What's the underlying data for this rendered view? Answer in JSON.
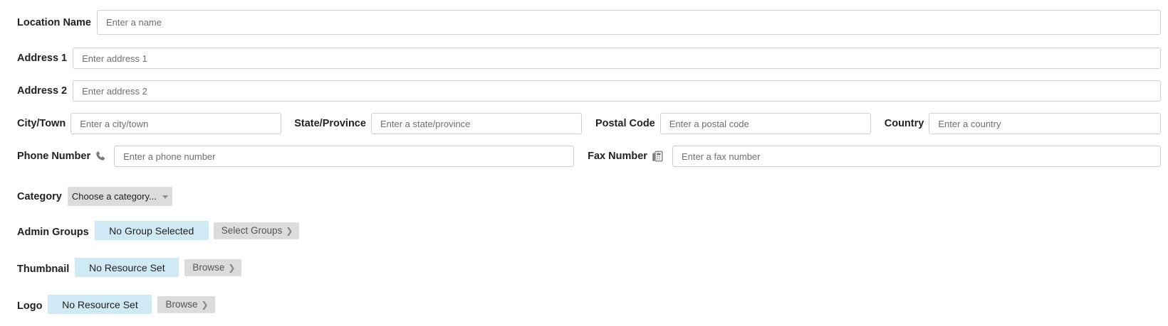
{
  "location_name": {
    "label": "Location Name",
    "placeholder": "Enter a name",
    "value": ""
  },
  "address1": {
    "label": "Address 1",
    "placeholder": "Enter address 1",
    "value": ""
  },
  "address2": {
    "label": "Address 2",
    "placeholder": "Enter address 2",
    "value": ""
  },
  "city": {
    "label": "City/Town",
    "placeholder": "Enter a city/town",
    "value": ""
  },
  "state": {
    "label": "State/Province",
    "placeholder": "Enter a state/province",
    "value": ""
  },
  "postal": {
    "label": "Postal Code",
    "placeholder": "Enter a postal code",
    "value": ""
  },
  "country": {
    "label": "Country",
    "placeholder": "Enter a country",
    "value": ""
  },
  "phone": {
    "label": "Phone Number",
    "placeholder": "Enter a phone number",
    "value": "",
    "icon": "phone-icon"
  },
  "fax": {
    "label": "Fax Number",
    "placeholder": "Enter a fax number",
    "value": "",
    "icon": "fax-icon"
  },
  "category": {
    "label": "Category",
    "selected": "Choose a category..."
  },
  "admin_groups": {
    "label": "Admin Groups",
    "value": "No Group Selected",
    "button": "Select Groups"
  },
  "thumbnail": {
    "label": "Thumbnail",
    "value": "No Resource Set",
    "button": "Browse"
  },
  "logo": {
    "label": "Logo",
    "value": "No Resource Set",
    "button": "Browse"
  },
  "colors": {
    "chip_bg": "#cfe9f5",
    "button_bg": "#dcdcdc",
    "border": "#cfcfcf"
  }
}
